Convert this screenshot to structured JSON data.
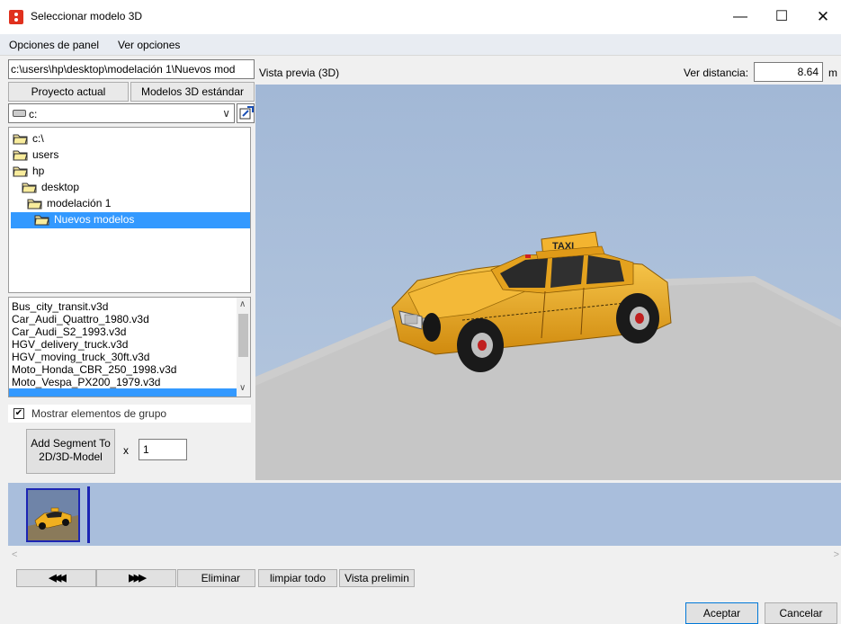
{
  "window": {
    "title": "Seleccionar modelo 3D",
    "minimize_symbol": "—",
    "maximize_symbol": "☐",
    "close_symbol": "✕"
  },
  "menu": {
    "items": [
      "Opciones de panel",
      "Ver opciones"
    ]
  },
  "left": {
    "path_value": "c:\\users\\hp\\desktop\\modelación 1\\Nuevos mod",
    "tabs": [
      "Proyecto actual",
      "Modelos 3D estándar"
    ],
    "drive": {
      "selected": "c:",
      "icon": "drive-icon",
      "dropdown_icon": "chevron-down-icon"
    },
    "new_folder_icon": "new-folder-icon",
    "tree": [
      {
        "label": "c:\\",
        "level": 0,
        "selected": false
      },
      {
        "label": "users",
        "level": 1,
        "selected": false
      },
      {
        "label": "hp",
        "level": 1,
        "selected": false
      },
      {
        "label": "desktop",
        "level": 2,
        "selected": false
      },
      {
        "label": "modelación 1",
        "level": 3,
        "selected": false
      },
      {
        "label": "Nuevos modelos",
        "level": 4,
        "selected": true
      }
    ],
    "files": [
      "Bus_city_transit.v3d",
      "Car_Audi_Quattro_1980.v3d",
      "Car_Audi_S2_1993.v3d",
      "HGV_delivery_truck.v3d",
      "HGV_moving_truck_30ft.v3d",
      "Moto_Honda_CBR_250_1998.v3d",
      "Moto_Vespa_PX200_1979.v3d"
    ],
    "show_group_label": "Mostrar elementos de grupo",
    "show_group_checked": true,
    "add_segment_label_1": "Add Segment To",
    "add_segment_label_2": "2D/3D-Model",
    "multiplier_label": "x",
    "multiplier_value": "1"
  },
  "preview": {
    "title": "Vista previa (3D)",
    "distance_label": "Ver distancia:",
    "distance_value": "8.64",
    "distance_unit": "m",
    "taxi_sign": "TAXI"
  },
  "bottom": {
    "rewind_label": "◀◀◀",
    "forward_label": "▶▶▶",
    "delete_label": "Eliminar",
    "clear_label": "limpiar todo",
    "preview_label": "Vista prelimin",
    "scroll_left": "<",
    "scroll_right": ">"
  },
  "footer": {
    "accept_label": "Aceptar",
    "cancel_label": "Cancelar"
  },
  "colors": {
    "sky": "#a6bbd8",
    "floor": "#c9c9c9",
    "taxi": "#f0b020",
    "selection": "#3399ff",
    "thumb_border": "#1c25b3"
  }
}
